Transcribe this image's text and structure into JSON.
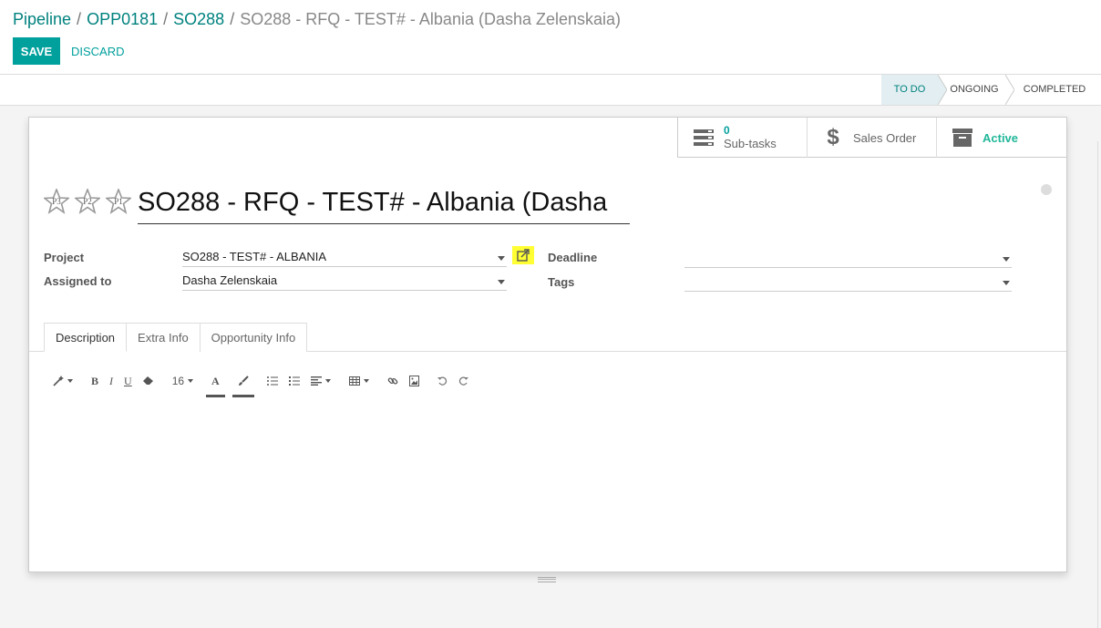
{
  "breadcrumb": {
    "items": [
      "Pipeline",
      "OPP0181",
      "SO288"
    ],
    "current": "SO288 - RFQ - TEST# - Albania (Dasha Zelenskaia)",
    "separator": "/"
  },
  "actions": {
    "save": "SAVE",
    "discard": "DISCARD"
  },
  "stages": {
    "todo": "TO DO",
    "ongoing": "ONGOING",
    "completed": "COMPLETED",
    "active": "TO DO"
  },
  "smart_buttons": {
    "subtasks_count": "0",
    "subtasks_label": "Sub-tasks",
    "sales_order": "Sales Order",
    "active": "Active"
  },
  "priority": [
    "P3",
    "P2",
    "P1"
  ],
  "task_title": "SO288 - RFQ - TEST# - Albania (Dasha",
  "fields": {
    "project_label": "Project",
    "project_value": "SO288 - TEST# - ALBANIA",
    "assigned_label": "Assigned to",
    "assigned_value": "Dasha Zelenskaia",
    "deadline_label": "Deadline",
    "deadline_value": "",
    "tags_label": "Tags",
    "tags_value": ""
  },
  "tabs": [
    "Description",
    "Extra Info",
    "Opportunity Info"
  ],
  "editor": {
    "font_size": "16"
  },
  "colors": {
    "primary": "#00a09d",
    "link": "#00827f",
    "highlight": "#ffff33",
    "active_green": "#21b799"
  }
}
